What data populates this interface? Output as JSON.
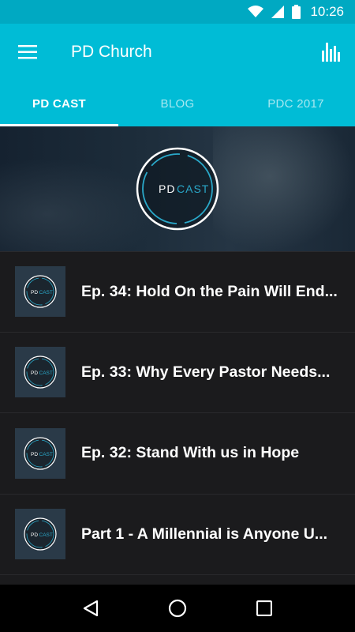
{
  "status_bar": {
    "time": "10:26",
    "icons": [
      "wifi-icon",
      "signal-icon",
      "battery-icon"
    ]
  },
  "app_bar": {
    "title": "PD Church",
    "menu_icon": "hamburger-menu-icon",
    "action_icon": "equalizer-icon"
  },
  "tabs": [
    {
      "label": "PD CAST",
      "active": true
    },
    {
      "label": "BLOG",
      "active": false
    },
    {
      "label": "PDC 2017",
      "active": false
    }
  ],
  "hero": {
    "logo_left": "PD",
    "logo_right": "CAST"
  },
  "episodes": [
    {
      "title": "Ep. 34: Hold On the Pain Will End...",
      "thumb_left": "PD",
      "thumb_right": "CAST"
    },
    {
      "title": "Ep. 33: Why Every Pastor Needs...",
      "thumb_left": "PD",
      "thumb_right": "CAST"
    },
    {
      "title": "Ep. 32: Stand With us in Hope",
      "thumb_left": "PD",
      "thumb_right": "CAST"
    },
    {
      "title": "Part 1 - A Millennial is Anyone U...",
      "thumb_left": "PD",
      "thumb_right": "CAST"
    }
  ],
  "nav_bar": {
    "icons": [
      "back-icon",
      "home-icon",
      "recents-icon"
    ]
  },
  "colors": {
    "primary": "#00bcd6",
    "status": "#00a9c2",
    "background": "#1b1b1d",
    "accent_ring": "#2aa8c9"
  }
}
